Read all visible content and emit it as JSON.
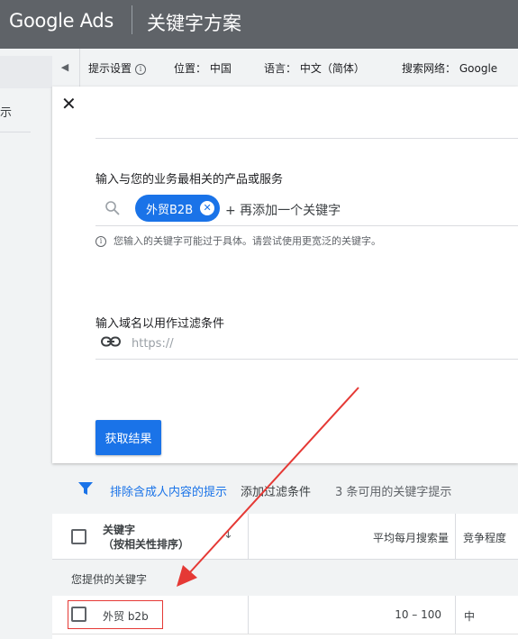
{
  "header": {
    "logo": "Google Ads",
    "title": "关键字方案"
  },
  "sidebar": {
    "partial_text": "示"
  },
  "settings_bar": {
    "hints_label": "提示设置",
    "location_label": "位置：",
    "location_value": "中国",
    "language_label": "语言：",
    "language_value": "中文（简体）",
    "network_label": "搜索网络：",
    "network_value": "Google"
  },
  "form": {
    "products_label": "输入与您的业务最相关的产品或服务",
    "keyword_chip": "外贸B2B",
    "add_more_placeholder": "+ 再添加一个关键字",
    "warning": "您输入的关键字可能过于具体。请尝试使用更宽泛的关键字。",
    "domain_label": "输入域名以用作过滤条件",
    "domain_placeholder": "https://",
    "submit_label": "获取结果"
  },
  "filter_bar": {
    "exclude_adult": "排除含成人内容的提示",
    "add_filter": "添加过滤条件",
    "available_count": "3 条可用的关键字提示"
  },
  "table": {
    "col_keyword_line1": "关键字",
    "col_keyword_line2": "（按相关性排序）",
    "col_avg_searches": "平均每月搜索量",
    "col_competition": "竞争程度",
    "group_label": "您提供的关键字",
    "rows": [
      {
        "keyword": "外贸 b2b",
        "avg_searches": "10 – 100",
        "competition": "中"
      }
    ]
  },
  "colors": {
    "accent": "#1a73e8",
    "header_bg": "#5f6368",
    "annotation": "#e53935"
  }
}
